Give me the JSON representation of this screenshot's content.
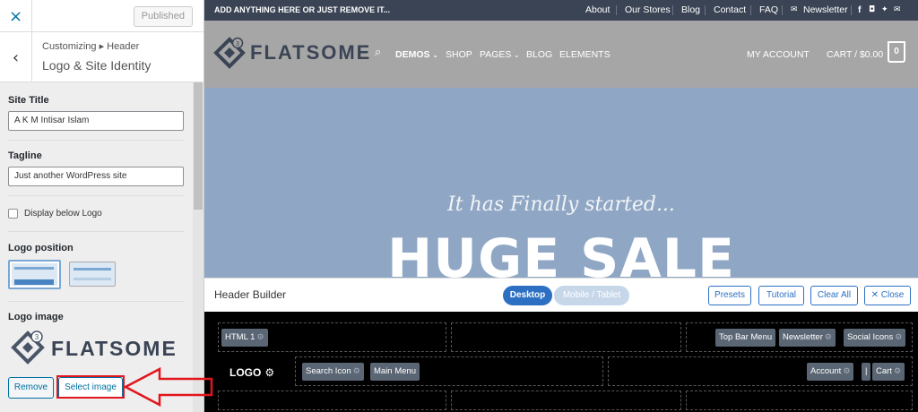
{
  "sidebar": {
    "close_icon": "×",
    "published_label": "Published",
    "breadcrumb": "Customizing ▸ Header",
    "section_title": "Logo & Site Identity",
    "site_title": {
      "label": "Site Title",
      "value": "A K M Intisar Islam"
    },
    "tagline": {
      "label": "Tagline",
      "value": "Just another WordPress site"
    },
    "display_below_logo": {
      "label": "Display below Logo",
      "checked": false
    },
    "logo_position_label": "Logo position",
    "logo_image_label": "Logo image",
    "logo_text": "FLATSOME",
    "logo_badge": "3",
    "remove_label": "Remove",
    "select_image_label": "Select image"
  },
  "topbar": {
    "promo": "ADD ANYTHING HERE OR JUST REMOVE IT...",
    "links": [
      "About",
      "Our Stores",
      "Blog",
      "Contact",
      "FAQ"
    ],
    "newsletter": "Newsletter"
  },
  "header": {
    "logo_text": "FLATSOME",
    "logo_badge": "3",
    "nav": [
      "DEMOS",
      "SHOP",
      "PAGES",
      "BLOG",
      "ELEMENTS"
    ],
    "account": "MY ACCOUNT",
    "cart": "CART / $0.00",
    "cart_count": "0"
  },
  "hero": {
    "script": "It has Finally started...",
    "headline": "HUGE SALE"
  },
  "header_builder": {
    "title": "Header Builder",
    "desktop": "Desktop",
    "mobile": "Mobile / Tablet",
    "presets": "Presets",
    "tutorial": "Tutorial",
    "clear_all": "Clear All",
    "close": "✕ Close",
    "chips": {
      "html1": "HTML 1",
      "top_bar_menu": "Top Bar Menu",
      "newsletter": "Newsletter",
      "social_icons": "Social Icons",
      "logo": "LOGO",
      "search_icon": "Search Icon",
      "main_menu": "Main Menu",
      "account": "Account",
      "divider": "|",
      "cart": "Cart"
    }
  },
  "colors": {
    "accent": "#2d70c3",
    "topbar": "#3b4454",
    "highlight": "#e2141c"
  }
}
